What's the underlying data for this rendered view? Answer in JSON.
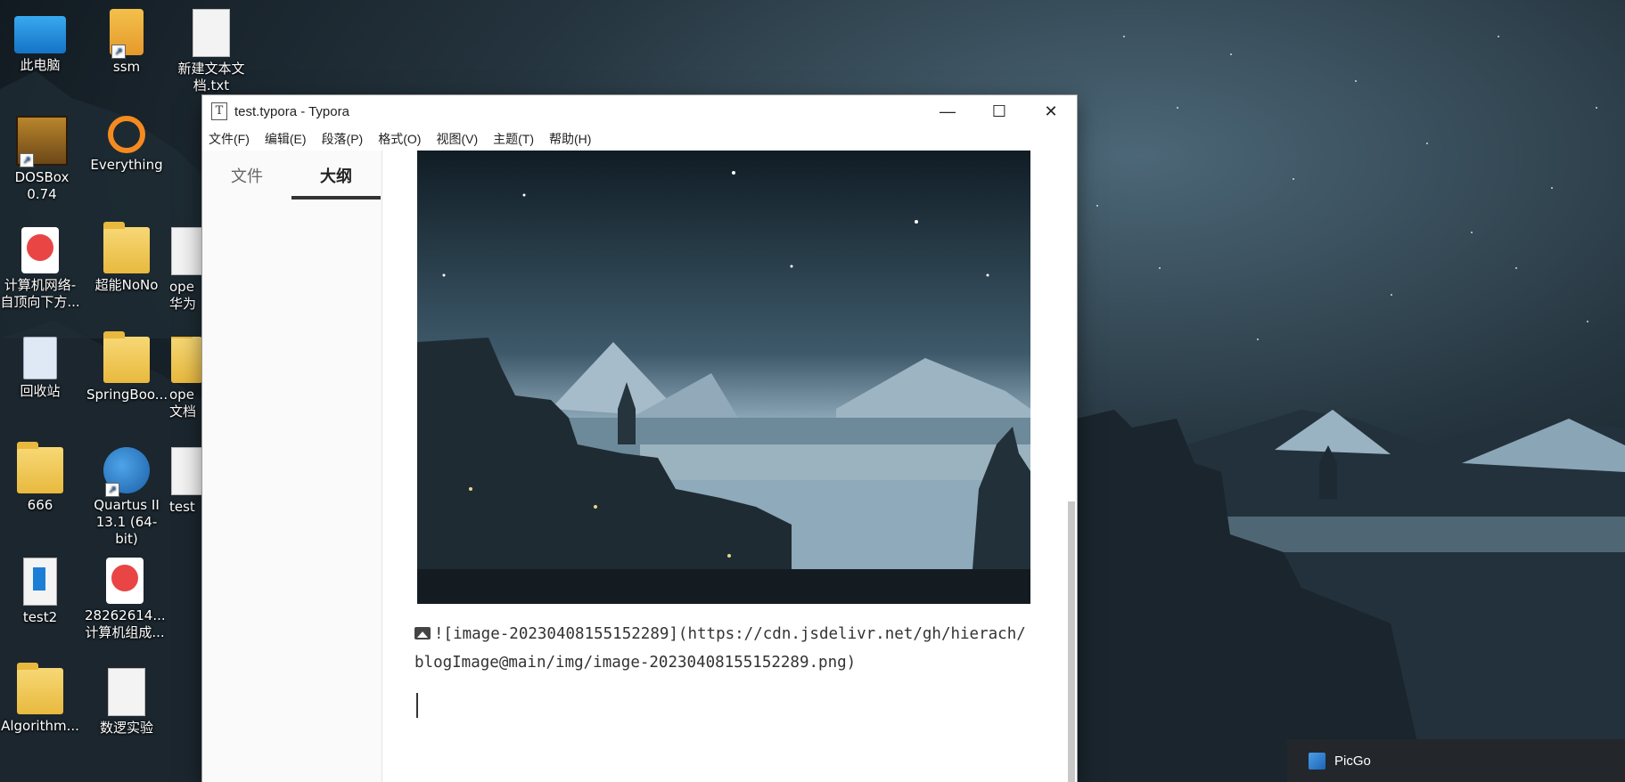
{
  "desktop": {
    "icons": [
      {
        "label": "此电脑",
        "icon": "this-pc-icon"
      },
      {
        "label": "ssm",
        "icon": "sublime-text-icon"
      },
      {
        "label": "新建文本文档.txt",
        "icon": "text-file-icon"
      },
      {
        "label": "DOSBox 0.74",
        "icon": "dosbox-icon"
      },
      {
        "label": "Everything",
        "icon": "everything-search-icon"
      },
      {
        "label": "计算机网络-自顶向下方...",
        "icon": "pdf-icon"
      },
      {
        "label": "超能NoNo",
        "icon": "folder-icon"
      },
      {
        "label": "ope 华为",
        "icon": "doc-icon"
      },
      {
        "label": "回收站",
        "icon": "recycle-bin-icon"
      },
      {
        "label": "SpringBoo...",
        "icon": "folder-icon"
      },
      {
        "label": "ope 文档",
        "icon": "folder-icon"
      },
      {
        "label": "666",
        "icon": "folder-icon"
      },
      {
        "label": "Quartus II 13.1 (64-bit)",
        "icon": "quartus-icon"
      },
      {
        "label": "test",
        "icon": "doc-icon"
      },
      {
        "label": "test2",
        "icon": "typora-file-icon"
      },
      {
        "label": "28262614... 计算机组成...",
        "icon": "pdf-icon"
      },
      {
        "label": "Algorithm...",
        "icon": "folder-icon"
      },
      {
        "label": "数逻实验",
        "icon": "folder-icon"
      }
    ]
  },
  "window": {
    "title": "test.typora - Typora",
    "app_icon_glyph": "T",
    "controls": {
      "minimize": "—",
      "maximize": "☐",
      "close": "✕"
    },
    "menu": [
      "文件(F)",
      "编辑(E)",
      "段落(P)",
      "格式(O)",
      "视图(V)",
      "主题(T)",
      "帮助(H)"
    ]
  },
  "sidebar": {
    "tabs": [
      {
        "label": "文件",
        "active": false
      },
      {
        "label": "大纲",
        "active": true
      }
    ]
  },
  "editor": {
    "image_markdown": "![image-20230408155152289](https://cdn.jsdelivr.net/gh/hierach/blogImage@main/img/image-20230408155152289.png)"
  },
  "taskbar_popup": {
    "label": "PicGo"
  }
}
